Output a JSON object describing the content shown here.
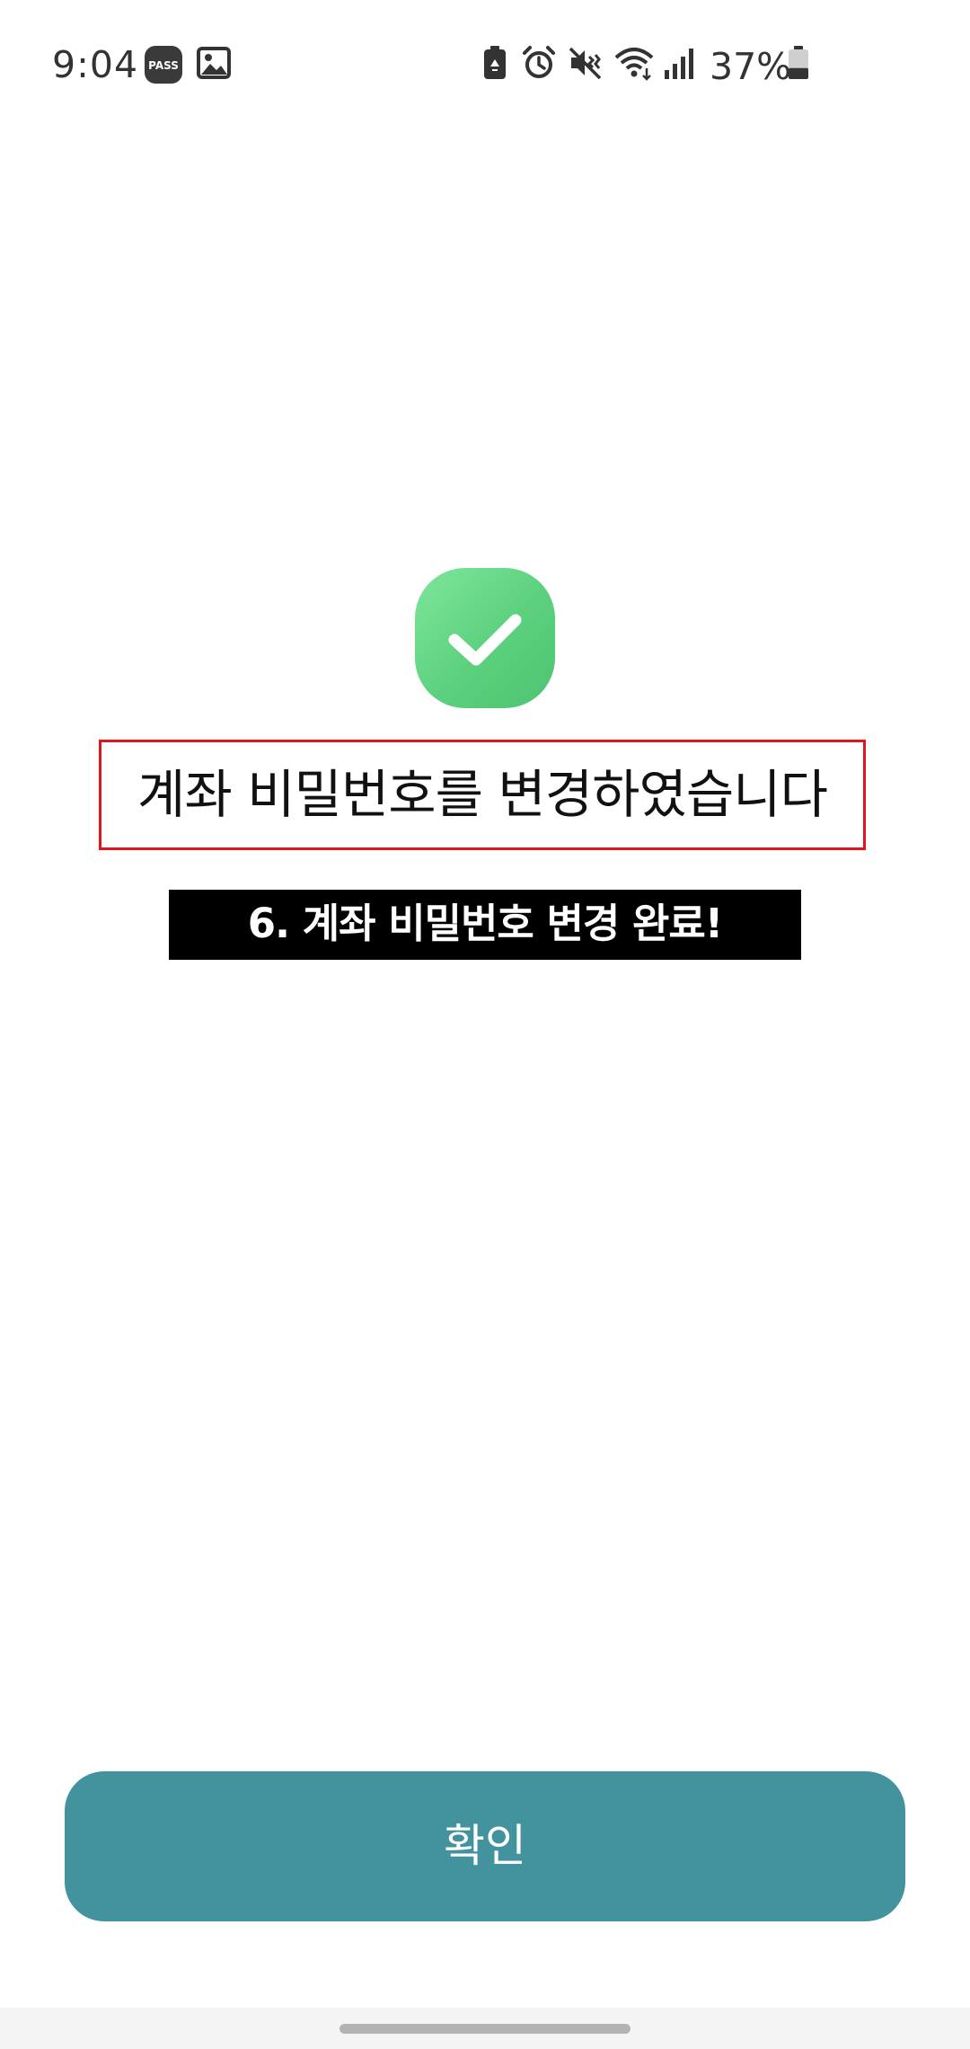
{
  "status_bar": {
    "time": "9:04",
    "battery_percent": "37%",
    "battery_level": 0.37,
    "left_icons": [
      "pass-icon",
      "gallery-icon"
    ],
    "right_icons": [
      "battery-saver-icon",
      "alarm-icon",
      "mute-icon",
      "wifi-icon",
      "signal-icon",
      "battery-icon"
    ]
  },
  "main": {
    "success_icon": "checkmark-icon",
    "title": "계좌 비밀번호를 변경하였습니다",
    "caption": "6. 계좌 비밀번호 변경 완료!"
  },
  "footer": {
    "confirm_label": "확인"
  },
  "colors": {
    "success_green": "#64d47f",
    "highlight_border": "#e0161f",
    "button_teal": "#42939e",
    "caption_background": "#000000"
  }
}
